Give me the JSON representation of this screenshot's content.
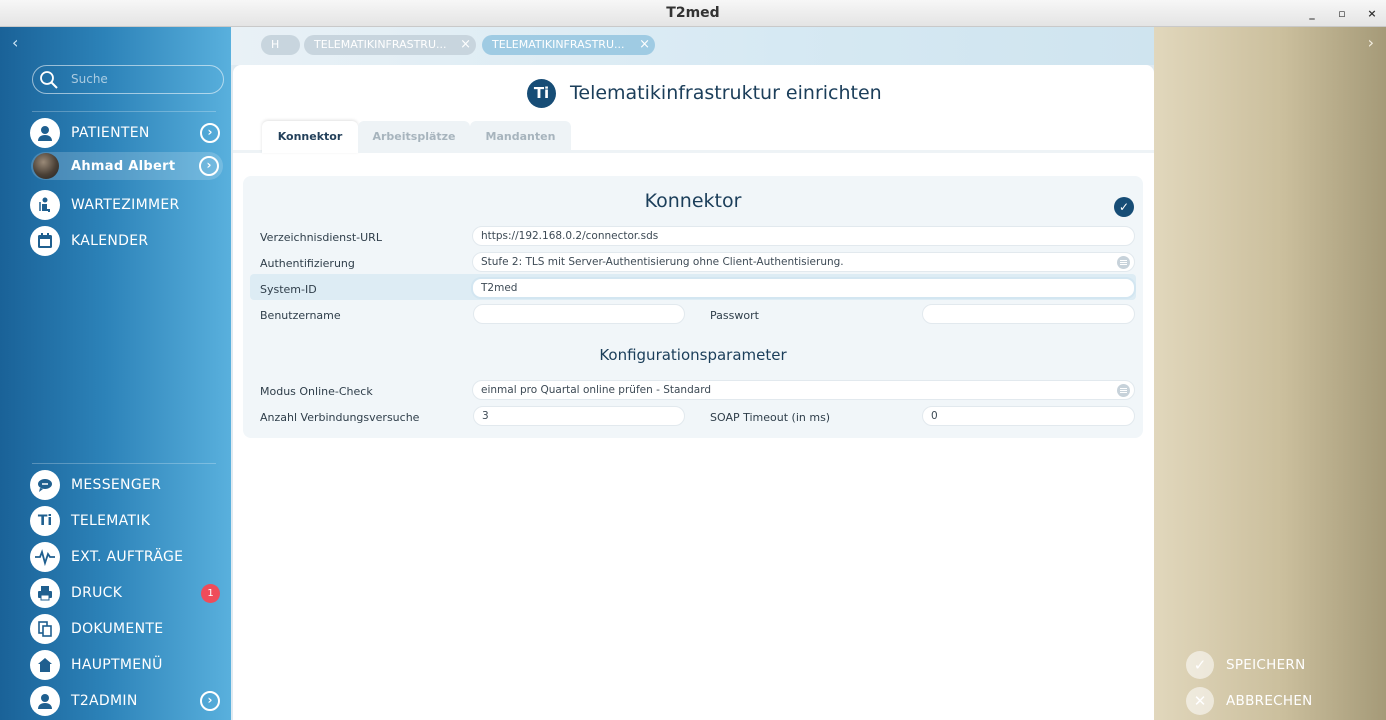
{
  "window": {
    "title": "T2med",
    "controls": [
      "_",
      "▫",
      "×"
    ]
  },
  "sidebar": {
    "search_placeholder": "Suche",
    "top_items": [
      {
        "label": "PATIENTEN",
        "icon": "patient-icon"
      },
      {
        "label": "Ahmad Albert",
        "icon": "avatar"
      },
      {
        "label": "WARTEZIMMER",
        "icon": "waiting-room-icon"
      },
      {
        "label": "KALENDER",
        "icon": "calendar-icon"
      }
    ],
    "bottom_items": [
      {
        "label": "MESSENGER",
        "icon": "chat-icon"
      },
      {
        "label": "TELEMATIK",
        "icon": "telematik-icon"
      },
      {
        "label": "EXT. AUFTRÄGE",
        "icon": "pulse-icon"
      },
      {
        "label": "DRUCK",
        "icon": "printer-icon",
        "badge": "1"
      },
      {
        "label": "DOKUMENTE",
        "icon": "documents-icon"
      },
      {
        "label": "HAUPTMENÜ",
        "icon": "home-icon"
      },
      {
        "label": "T2ADMIN",
        "icon": "admin-icon"
      }
    ]
  },
  "tabs": [
    {
      "label": "H"
    },
    {
      "label": "TELEMATIKINFRASTRU..."
    },
    {
      "label": "TELEMATIKINFRASTRU..."
    }
  ],
  "page": {
    "logo_text": "Ti",
    "title": "Telematikinfrastruktur einrichten",
    "subtabs": [
      "Konnektor",
      "Arbeitsplätze",
      "Mandanten"
    ]
  },
  "konnektor": {
    "title": "Konnektor",
    "fields": {
      "url_label": "Verzeichnisdienst-URL",
      "url_value": "https://192.168.0.2/connector.sds",
      "auth_label": "Authentifizierung",
      "auth_value": "Stufe 2: TLS mit Server-Authentisierung ohne Client-Authentisierung.",
      "system_id_label": "System-ID",
      "system_id_value": "T2med",
      "username_label": "Benutzername",
      "username_value": "",
      "password_label": "Passwort",
      "password_value": ""
    },
    "config_title": "Konfigurationsparameter",
    "config": {
      "mode_label": "Modus Online-Check",
      "mode_value": "einmal pro Quartal online prüfen - Standard",
      "attempts_label": "Anzahl Verbindungsversuche",
      "attempts_value": "3",
      "timeout_label": "SOAP Timeout (in ms)",
      "timeout_value": "0"
    }
  },
  "actions": {
    "save": "SPEICHERN",
    "cancel": "ABBRECHEN"
  },
  "colors": {
    "sidebar_dark": "#1a6298",
    "sidebar_light": "#59b0dd",
    "accent": "#174d76",
    "badge": "#ef4c5a",
    "right_panel": "#cbbf9d"
  }
}
